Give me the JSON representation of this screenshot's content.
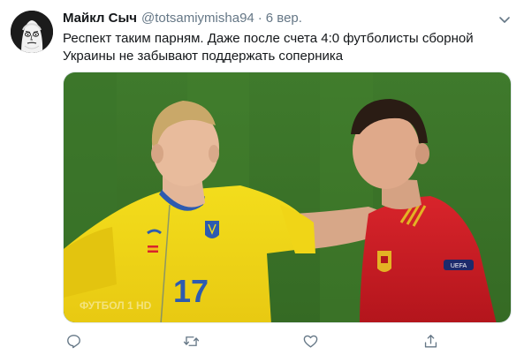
{
  "tweet": {
    "author": {
      "display_name": "Майкл Сыч",
      "handle": "@totsamiymisha94",
      "separator": "·",
      "time": "6 вер."
    },
    "text_lines": [
      "Респект таким парням. Даже после счета 4:0 футболисты сборной",
      "Украины не забывают поддержать соперника"
    ],
    "media": {
      "shirt_number": "17",
      "watermark": "ФУТБОЛ 1 HD",
      "sleeve_badge": "UEFA"
    },
    "icons": {
      "avatar": "meme-face-avatar",
      "menu": "chevron-down-icon",
      "reply": "reply-icon",
      "retweet": "retweet-icon",
      "like": "heart-icon",
      "share": "share-icon"
    },
    "colors": {
      "text": "#14171a",
      "secondary": "#657786",
      "border": "#e1e8ed"
    }
  }
}
